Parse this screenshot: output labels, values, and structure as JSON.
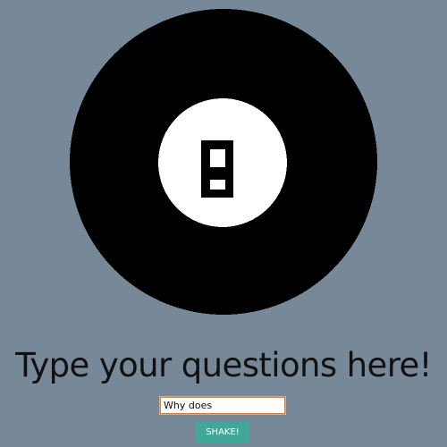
{
  "ball": {
    "number": "8",
    "colors": {
      "shell": "#000000",
      "window": "#ffffff",
      "digit": "#000000",
      "background": "#778899"
    }
  },
  "prompt": {
    "text": "Type your questions here!"
  },
  "question": {
    "value": "Why does",
    "placeholder": ""
  },
  "shake": {
    "label": "SHAKE!",
    "color": "#3fa89a"
  }
}
